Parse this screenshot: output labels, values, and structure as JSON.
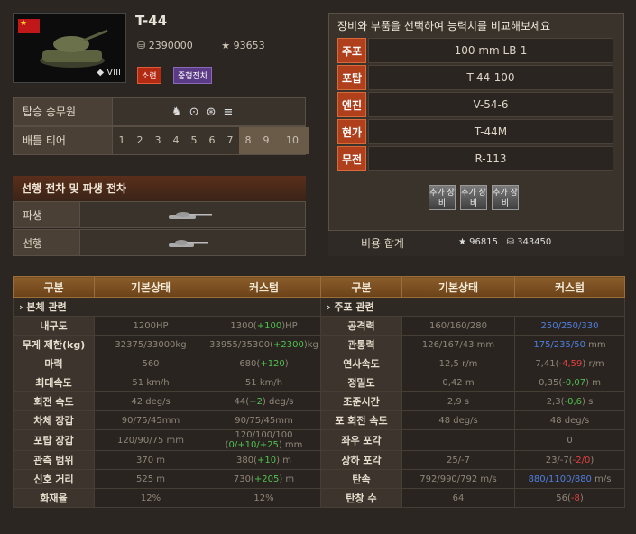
{
  "tank": {
    "name": "T-44",
    "tier_roman": "VIII",
    "credit_price": "2390000",
    "xp_price": "93653",
    "country_tag": "소련",
    "class_tag": "중형전차",
    "flag_icon": "ussr-flag-icon"
  },
  "crew": {
    "label": "탑승 승무원",
    "icons": [
      "commander-icon",
      "gunner-icon",
      "driver-icon",
      "radio-icon",
      "loader-icon"
    ]
  },
  "tier_row": {
    "label": "배틀 티어",
    "tiers": [
      "1",
      "2",
      "3",
      "4",
      "5",
      "6",
      "7",
      "8",
      "9",
      "10"
    ],
    "highlighted": [
      "8",
      "9",
      "10"
    ]
  },
  "lineage": {
    "title": "선행 전차 및 파생 전차",
    "derived_label": "파생",
    "previous_label": "선행"
  },
  "modules": {
    "title": "장비와 부품을 선택하여 능력치를 비교해보세요",
    "rows": [
      {
        "key": "주포",
        "value": "100 mm LB-1"
      },
      {
        "key": "포탑",
        "value": "T-44-100"
      },
      {
        "key": "엔진",
        "value": "V-54-6"
      },
      {
        "key": "현가",
        "value": "T-44M"
      },
      {
        "key": "무전",
        "value": "R-113"
      }
    ],
    "extra_buttons": [
      "추가 장비",
      "추가 장비",
      "추가 장비"
    ],
    "cost": {
      "label": "비용 합계",
      "xp": "96815",
      "credits": "343450"
    }
  },
  "compare": {
    "headers": [
      "구분",
      "기본상태",
      "커스텀",
      "구분",
      "기본상태",
      "커스텀"
    ],
    "left_section": "본체 관련",
    "right_section": "주포 관련",
    "left": [
      {
        "label": "내구도",
        "base": "1200HP",
        "c1": "1300(",
        "c2": "+100",
        "c3": ")HP",
        "c2class": "g"
      },
      {
        "label": "무게 제한(kg)",
        "base": "32375/33000kg",
        "c1": "33955/35300(",
        "c2": "+2300",
        "c3": ")kg",
        "c2class": "g"
      },
      {
        "label": "마력",
        "base": "560",
        "c1": "680(",
        "c2": "+120",
        "c3": ")",
        "c2class": "g"
      },
      {
        "label": "최대속도",
        "base": "51 km/h",
        "c1": "51 km/h",
        "c2": "",
        "c3": "",
        "c2class": ""
      },
      {
        "label": "회전 속도",
        "base": "42 deg/s",
        "c1": "44(",
        "c2": "+2",
        "c3": ") deg/s",
        "c2class": "g"
      },
      {
        "label": "차체 장갑",
        "base": "90/75/45mm",
        "c1": "90/75/45mm",
        "c2": "",
        "c3": "",
        "c2class": ""
      },
      {
        "label": "포탑 장갑",
        "base": "120/90/75 mm",
        "c1": "120/100/100 (",
        "c2": "0/+10/+25",
        "c3": ") mm",
        "c2class": "g"
      },
      {
        "label": "관측 범위",
        "base": "370 m",
        "c1": "380(",
        "c2": "+10",
        "c3": ") m",
        "c2class": "g"
      },
      {
        "label": "신호 거리",
        "base": "525 m",
        "c1": "730(",
        "c2": "+205",
        "c3": ") m",
        "c2class": "g"
      },
      {
        "label": "화재율",
        "base": "12%",
        "c1": "12%",
        "c2": "",
        "c3": "",
        "c2class": ""
      }
    ],
    "right": [
      {
        "label": "공격력",
        "base": "160/160/280",
        "c1": "",
        "c2": "250/250/330",
        "c3": "",
        "c2class": "b"
      },
      {
        "label": "관통력",
        "base": "126/167/43 mm",
        "c1": "",
        "c2": "175/235/50",
        "c3": " mm",
        "c2class": "b"
      },
      {
        "label": "연사속도",
        "base": "12,5 r/m",
        "c1": "7,41(",
        "c2": "-4,59",
        "c3": ") r/m",
        "c2class": "r"
      },
      {
        "label": "정밀도",
        "base": "0,42 m",
        "c1": "0,35(",
        "c2": "-0,07",
        "c3": ") m",
        "c2class": "g"
      },
      {
        "label": "조준시간",
        "base": "2,9 s",
        "c1": "2,3(",
        "c2": "-0,6",
        "c3": ") s",
        "c2class": "g"
      },
      {
        "label": "포 회전 속도",
        "base": "48 deg/s",
        "c1": "48 deg/s",
        "c2": "",
        "c3": "",
        "c2class": ""
      },
      {
        "label": "좌우 포각",
        "base": "",
        "c1": "0",
        "c2": "",
        "c3": "",
        "c2class": ""
      },
      {
        "label": "상하 포각",
        "base": "25/-7",
        "c1": "23/-7(",
        "c2": "-2/0",
        "c3": ")",
        "c2class": "r"
      },
      {
        "label": "탄속",
        "base": "792/990/792 m/s",
        "c1": "",
        "c2": "880/1100/880",
        "c3": " m/s",
        "c2class": "b"
      },
      {
        "label": "탄창 수",
        "base": "64",
        "c1": "56(",
        "c2": "-8",
        "c3": ")",
        "c2class": "r"
      }
    ]
  }
}
